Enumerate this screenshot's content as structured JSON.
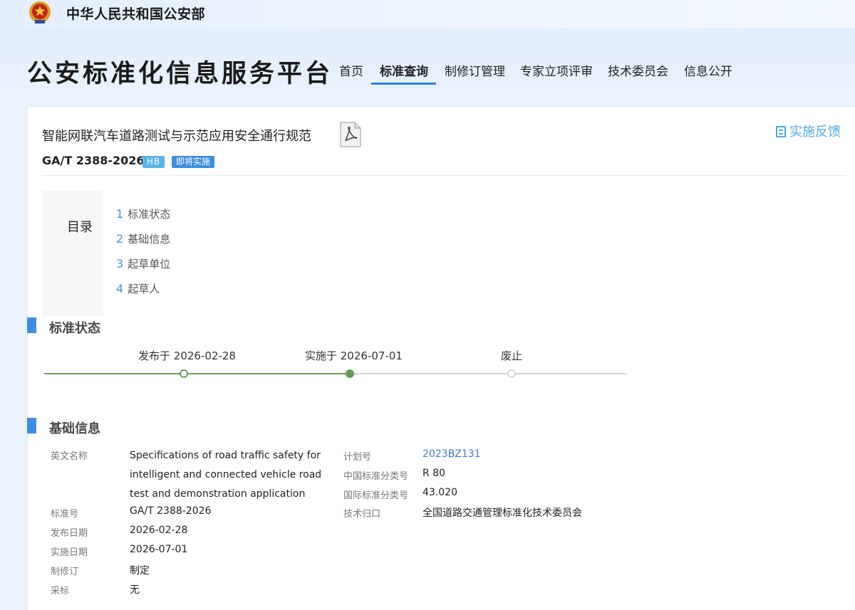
{
  "header": {
    "ministry_name": "中华人民共和国公安部",
    "platform_title": "公安标准化信息服务平台",
    "nav": [
      {
        "label": "首页",
        "active": false
      },
      {
        "label": "标准查询",
        "active": true
      },
      {
        "label": "制修订管理",
        "active": false
      },
      {
        "label": "专家立项评审",
        "active": false
      },
      {
        "label": "技术委员会",
        "active": false
      },
      {
        "label": "信息公开",
        "active": false
      }
    ],
    "accent_color": "#2f7fd8"
  },
  "standard": {
    "title": "智能网联汽车道路测试与示范应用安全通行规范",
    "code": "GA/T 2388-2026",
    "badge_type": "HB",
    "badge_status": "即将实施",
    "feedback_label": "实施反馈"
  },
  "toc": {
    "heading": "目录",
    "items": [
      {
        "num": "1",
        "label": "标准状态"
      },
      {
        "num": "2",
        "label": "基础信息"
      },
      {
        "num": "3",
        "label": "起草单位"
      },
      {
        "num": "4",
        "label": "起草人"
      }
    ]
  },
  "status_section": {
    "title": "标准状态",
    "timeline": [
      {
        "label": "发布于 2026-02-28",
        "reached": true
      },
      {
        "label": "实施于 2026-07-01",
        "reached": true,
        "current": true
      },
      {
        "label": "废止",
        "reached": false
      }
    ],
    "progress_color": "#6b9a5e"
  },
  "basic_section": {
    "title": "基础信息",
    "left": [
      {
        "label": "英文名称",
        "value": "Specifications of road traffic safety for intelligent and connected vehicle road test and demonstration application"
      },
      {
        "label": "标准号",
        "value": "GA/T 2388-2026"
      },
      {
        "label": "发布日期",
        "value": "2026-02-28"
      },
      {
        "label": "实施日期",
        "value": "2026-07-01"
      },
      {
        "label": "制修订",
        "value": "制定"
      },
      {
        "label": "采标",
        "value": "无"
      }
    ],
    "right": [
      {
        "label": "计划号",
        "value": "2023BZ131"
      },
      {
        "label": "中国标准分类号",
        "value": "R 80"
      },
      {
        "label": "国际标准分类号",
        "value": "43.020"
      },
      {
        "label": "技术归口",
        "value": "全国道路交通管理标准化技术委员会"
      }
    ]
  }
}
